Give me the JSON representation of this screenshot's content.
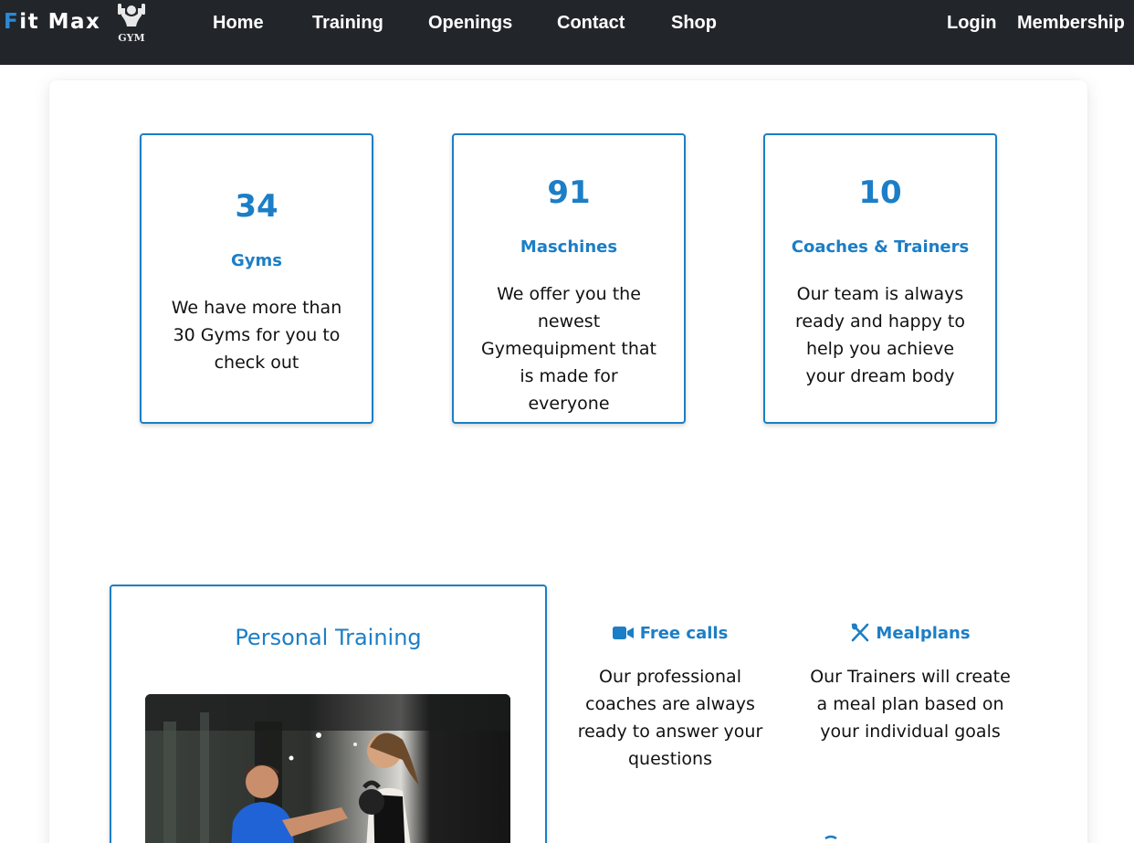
{
  "nav": {
    "brand_first": "F",
    "brand_rest": "it Max",
    "logo_text": "GYM",
    "links": [
      "Home",
      "Training",
      "Openings",
      "Contact",
      "Shop"
    ],
    "login": "Login",
    "membership": "Membership"
  },
  "stats": [
    {
      "number": "34",
      "title": "Gyms",
      "description": "We have more than 30 Gyms for you to check out"
    },
    {
      "number": "91",
      "title": "Maschines",
      "description": "We offer you the newest Gymequipment that is made for everyone"
    },
    {
      "number": "10",
      "title": "Coaches & Trainers",
      "description": "Our team is always ready and happy to help you achieve your dream body"
    }
  ],
  "personal_training": {
    "title": "Personal Training"
  },
  "features": [
    {
      "title": "Free calls",
      "icon": "video-camera-icon",
      "description": "Our professional coaches are always ready to answer your questions"
    },
    {
      "title": "Mealplans",
      "icon": "utensils-icon",
      "description": "Our Trainers will create a meal plan based on your individual goals"
    }
  ],
  "colors": {
    "navbar": "#22252a",
    "accent": "#1c7ec6",
    "brand_accent": "#2b8ad6"
  }
}
